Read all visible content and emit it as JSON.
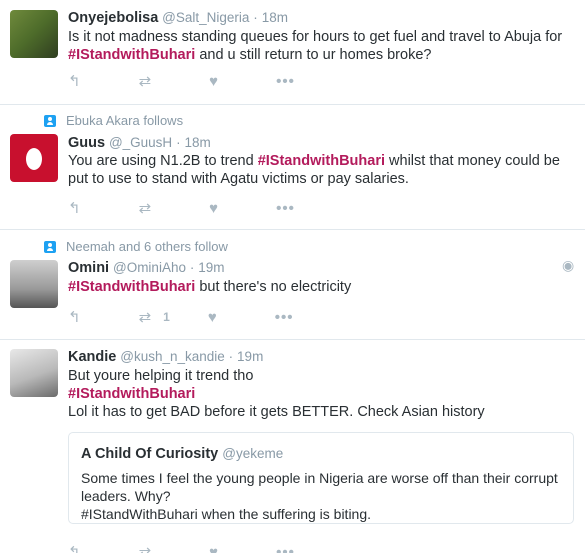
{
  "tweets": [
    {
      "name": "Onyejebolisa",
      "handle": "@Salt_Nigeria",
      "time": "18m",
      "text_before": "Is it not madness standing queues for hours to get fuel and travel to Abuja for ",
      "hashtag": "#IStandwithBuhari",
      "text_after": " and u still return to ur homes broke?"
    },
    {
      "context": "Ebuka Akara follows",
      "name": "Guus",
      "handle": "@_GuusH",
      "time": "18m",
      "text_before": "You are using N1.2B to trend ",
      "hashtag": "#IStandwithBuhari",
      "text_after": " whilst that money could be put to use to stand with Agatu victims or pay salaries."
    },
    {
      "context": "Neemah and 6 others follow",
      "name": "Omini",
      "handle": "@OminiAho",
      "time": "19m",
      "hashtag": "#IStandwithBuhari",
      "text_after": " but there's no electricity",
      "retweet_count": "1"
    },
    {
      "name": "Kandie",
      "handle": "@kush_n_kandie",
      "time": "19m",
      "line1": "But youre helping it trend tho",
      "hashtag": "#IStandwithBuhari",
      "line3": "Lol it has to get BAD before it gets BETTER. Check Asian history",
      "quote": {
        "name": "A Child Of Curiosity",
        "handle": "@yekeme",
        "line1": "Some times I feel the young people in Nigeria are worse off than their corrupt leaders. Why?",
        "line2": "#IStandWithBuhari when the suffering is biting."
      }
    }
  ],
  "separator": "·",
  "icons": {
    "reply": "reply-icon",
    "retweet": "retweet-icon",
    "like": "heart-icon",
    "more": "more-icon",
    "follow_context": "person-icon",
    "geo": "location-pin-icon"
  },
  "colors": {
    "hashtag": "#b31b5c",
    "muted": "#8899a6",
    "icon": "#aab8c2",
    "context_icon": "#1da1f2"
  }
}
